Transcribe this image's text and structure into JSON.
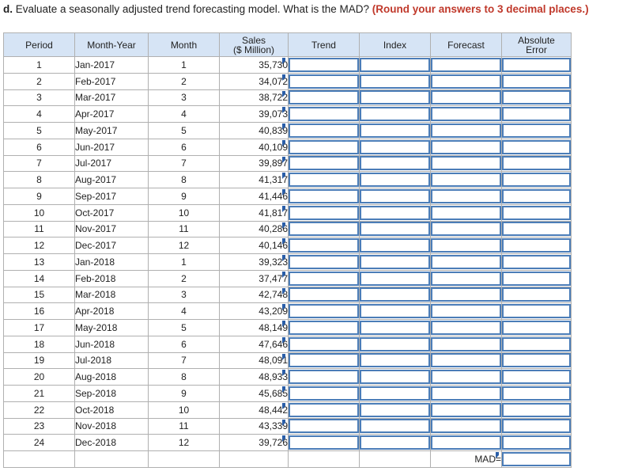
{
  "question": {
    "lead": "d.",
    "text": " Evaluate a seasonally adjusted trend forecasting model. What is the MAD? ",
    "emphasis": "(Round your answers to 3 decimal places.)"
  },
  "table": {
    "headers": {
      "period": "Period",
      "month_year": "Month-Year",
      "month": "Month",
      "sales_line1": "Sales",
      "sales_line2": "($ Million)",
      "trend": "Trend",
      "index": "Index",
      "forecast": "Forecast",
      "abs_error_line1": "Absolute",
      "abs_error_line2": "Error"
    },
    "rows": [
      {
        "period": "1",
        "month_year": "Jan-2017",
        "month": "1",
        "sales": "35,730"
      },
      {
        "period": "2",
        "month_year": "Feb-2017",
        "month": "2",
        "sales": "34,072"
      },
      {
        "period": "3",
        "month_year": "Mar-2017",
        "month": "3",
        "sales": "38,722"
      },
      {
        "period": "4",
        "month_year": "Apr-2017",
        "month": "4",
        "sales": "39,073"
      },
      {
        "period": "5",
        "month_year": "May-2017",
        "month": "5",
        "sales": "40,839"
      },
      {
        "period": "6",
        "month_year": "Jun-2017",
        "month": "6",
        "sales": "40,109"
      },
      {
        "period": "7",
        "month_year": "Jul-2017",
        "month": "7",
        "sales": "39,897"
      },
      {
        "period": "8",
        "month_year": "Aug-2017",
        "month": "8",
        "sales": "41,317"
      },
      {
        "period": "9",
        "month_year": "Sep-2017",
        "month": "9",
        "sales": "41,446"
      },
      {
        "period": "10",
        "month_year": "Oct-2017",
        "month": "10",
        "sales": "41,817"
      },
      {
        "period": "11",
        "month_year": "Nov-2017",
        "month": "11",
        "sales": "40,286"
      },
      {
        "period": "12",
        "month_year": "Dec-2017",
        "month": "12",
        "sales": "40,146"
      },
      {
        "period": "13",
        "month_year": "Jan-2018",
        "month": "1",
        "sales": "39,323"
      },
      {
        "period": "14",
        "month_year": "Feb-2018",
        "month": "2",
        "sales": "37,477"
      },
      {
        "period": "15",
        "month_year": "Mar-2018",
        "month": "3",
        "sales": "42,748"
      },
      {
        "period": "16",
        "month_year": "Apr-2018",
        "month": "4",
        "sales": "43,209"
      },
      {
        "period": "17",
        "month_year": "May-2018",
        "month": "5",
        "sales": "48,149"
      },
      {
        "period": "18",
        "month_year": "Jun-2018",
        "month": "6",
        "sales": "47,646"
      },
      {
        "period": "19",
        "month_year": "Jul-2018",
        "month": "7",
        "sales": "48,091"
      },
      {
        "period": "20",
        "month_year": "Aug-2018",
        "month": "8",
        "sales": "48,933"
      },
      {
        "period": "21",
        "month_year": "Sep-2018",
        "month": "9",
        "sales": "45,685"
      },
      {
        "period": "22",
        "month_year": "Oct-2018",
        "month": "10",
        "sales": "48,442"
      },
      {
        "period": "23",
        "month_year": "Nov-2018",
        "month": "11",
        "sales": "43,339"
      },
      {
        "period": "24",
        "month_year": "Dec-2018",
        "month": "12",
        "sales": "39,726"
      }
    ],
    "mad_label": "MAD="
  }
}
